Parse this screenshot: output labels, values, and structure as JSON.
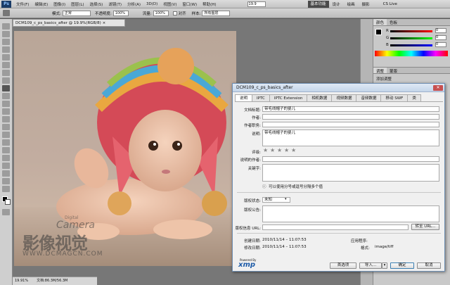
{
  "menubar": {
    "logo": "Ps",
    "items": [
      "文件(F)",
      "编辑(E)",
      "图像(I)",
      "图层(L)",
      "选择(S)",
      "滤镜(T)",
      "分析(A)",
      "3D(D)",
      "视图(V)",
      "窗口(W)",
      "帮助(H)"
    ],
    "zoom": "19.9",
    "workspace_active": "基本功能",
    "workspaces": [
      "设计",
      "绘画",
      "摄影"
    ],
    "cs_live": "CS Live"
  },
  "options": {
    "mode_label": "模式:",
    "mode_value": "正常",
    "opacity_label": "不透明度:",
    "opacity_value": "100%",
    "flow_label": "流量:",
    "flow_value": "100%",
    "align_label": "对齐",
    "sample_label": "样本:",
    "sample_value": "所有图层"
  },
  "document": {
    "tab_title": "DCM109_c_ps_basics_after @ 19.9%(RGB/8) ×",
    "watermark_cn": "影像视觉",
    "watermark_en": "Camera",
    "watermark_sub": "Digital",
    "watermark_url": "WWW.DCMAGCN.COM"
  },
  "status": {
    "zoom": "19.91%",
    "doc": "文档:86.3M/56.3M"
  },
  "panels": {
    "color_tab": "颜色",
    "swatch_tab": "色板",
    "adjust_tab": "调整",
    "mask_tab": "蒙版",
    "adjust_title": "添加调整",
    "r_label": "R",
    "g_label": "G",
    "b_label": "B",
    "r_value": "0",
    "g_value": "0",
    "b_value": "0"
  },
  "dialog": {
    "title": "DCM109_c_ps_basics_after",
    "close": "✕",
    "tabs": [
      "说明",
      "IPTC",
      "IPTC Extension",
      "相机数据",
      "视频数据",
      "音频数据",
      "移动 SWF",
      "类"
    ],
    "doc_title_label": "文档标题:",
    "doc_title_value": "带毛线帽子的婴儿",
    "author_label": "作者:",
    "author_title_label": "作者职务:",
    "desc_label": "说明:",
    "desc_value": "带毛线帽子的婴儿",
    "rating_label": "评级:",
    "desc_writer_label": "说明的作者:",
    "keywords_label": "关键字:",
    "keywords_hint": "可以使用分号或逗号分隔多个值",
    "copyright_status_label": "版权状态:",
    "copyright_status_value": "未知",
    "copyright_notice_label": "版权公告:",
    "copyright_url_label": "版权信息 URL:",
    "goto_url": "转至 URL...",
    "created_label": "创建日期:",
    "created_value": "2010/11/14 – 11:07:53",
    "modified_label": "修改日期:",
    "modified_value": "2010/11/14 – 11:07:53",
    "app_label": "应用程序:",
    "format_label": "格式:",
    "format_value": "image/tiff",
    "xmp_powered": "Powered By",
    "xmp": "xmp",
    "prefs_button": "首选项",
    "import_button": "导入...",
    "ok_button": "确定",
    "cancel_button": "取消"
  }
}
